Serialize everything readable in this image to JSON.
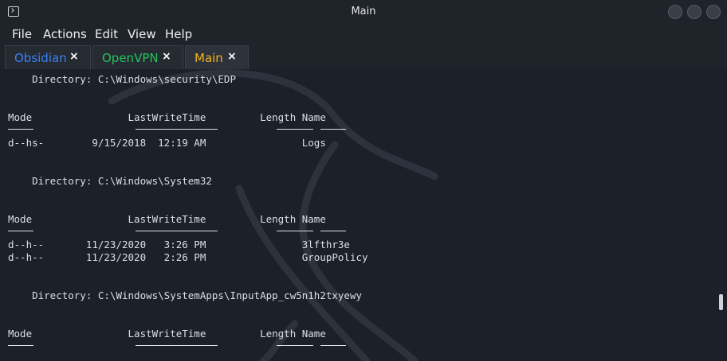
{
  "window": {
    "title": "Main"
  },
  "menu": [
    "File",
    "Actions",
    "Edit",
    "View",
    "Help"
  ],
  "tabs": [
    {
      "label": "Obsidian",
      "color": "#3b82f6"
    },
    {
      "label": "OpenVPN",
      "color": "#22c55e"
    },
    {
      "label": "Main",
      "color": "#f2b51e"
    }
  ],
  "tab_close": "×",
  "terminal": {
    "lines": [
      "    Directory: C:\\Windows\\security\\EDP",
      "Mode                LastWriteTime         Length Name",
      "d--hs-        9/15/2018  12:19 AM                Logs",
      "    Directory: C:\\Windows\\System32",
      "Mode                LastWriteTime         Length Name",
      "d--h--       11/23/2020   3:26 PM                3lfthr3e",
      "d--h--       11/23/2020   2:26 PM                GroupPolicy",
      "    Directory: C:\\Windows\\SystemApps\\InputApp_cw5n1h2txyewy",
      "Mode                LastWriteTime         Length Name"
    ]
  }
}
